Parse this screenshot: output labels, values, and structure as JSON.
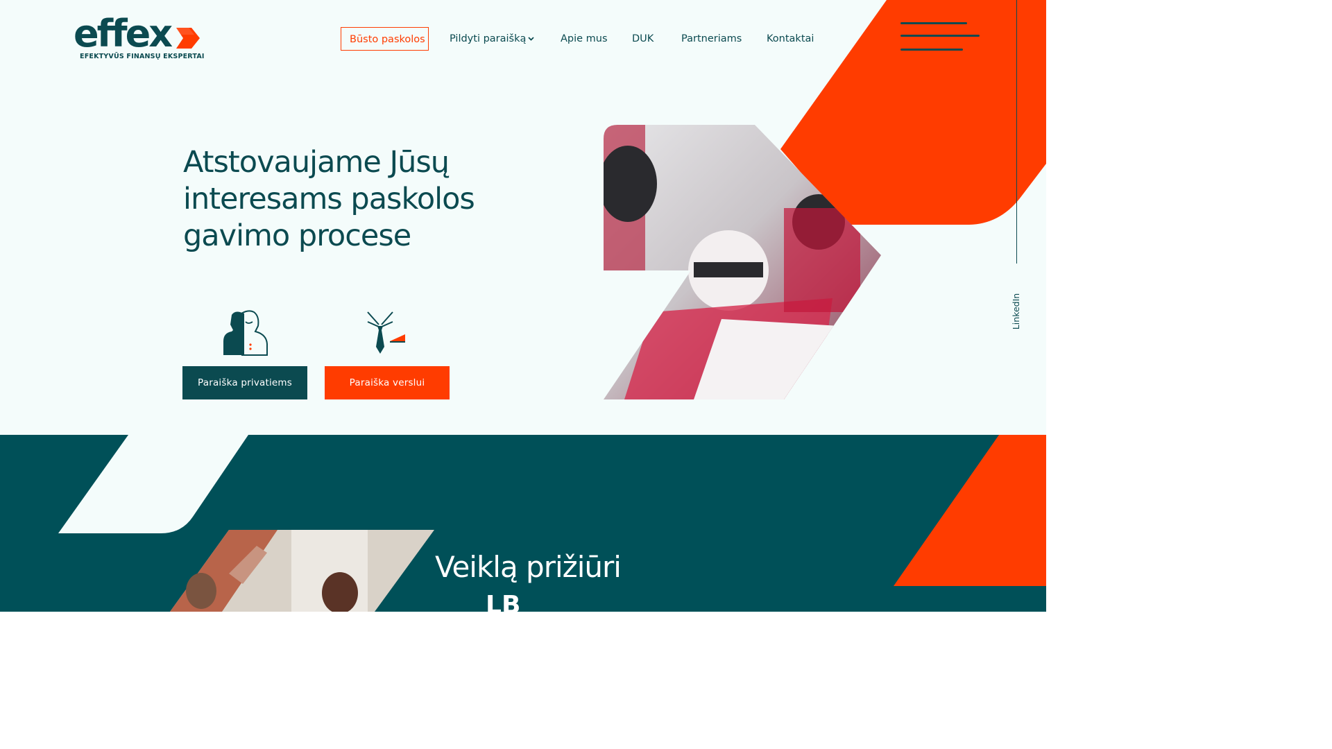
{
  "brand": {
    "name": "effex",
    "tagline": "EFEKTYVŪS FINANSŲ EKSPERTAI",
    "colors": {
      "teal": "#0b4a50",
      "dark_teal": "#005058",
      "orange": "#ff3c00",
      "background": "#f4fcfb"
    }
  },
  "nav": {
    "items": [
      {
        "label": "Būsto paskolos",
        "active": true
      },
      {
        "label": "Pildyti paraišką",
        "has_dropdown": true
      },
      {
        "label": "Apie mus"
      },
      {
        "label": "DUK"
      },
      {
        "label": "Partneriams"
      },
      {
        "label": "Kontaktai"
      }
    ],
    "menu_icon": "hamburger-icon"
  },
  "social": {
    "linkedin_label": "LinkedIn"
  },
  "hero": {
    "title": "Atstovaujame Jūsų interesams paskolos gavimo procese",
    "buttons": [
      {
        "label": "Paraiška privatiems",
        "icon": "private-person-icon"
      },
      {
        "label": "Paraiška verslui",
        "icon": "business-tie-icon"
      }
    ],
    "image_description_icon": "racing-pit-crew-image"
  },
  "section": {
    "title": "Veiklą prižiūri",
    "regulator_logo_text": "LB",
    "image_icon": "business-high-five-image"
  }
}
